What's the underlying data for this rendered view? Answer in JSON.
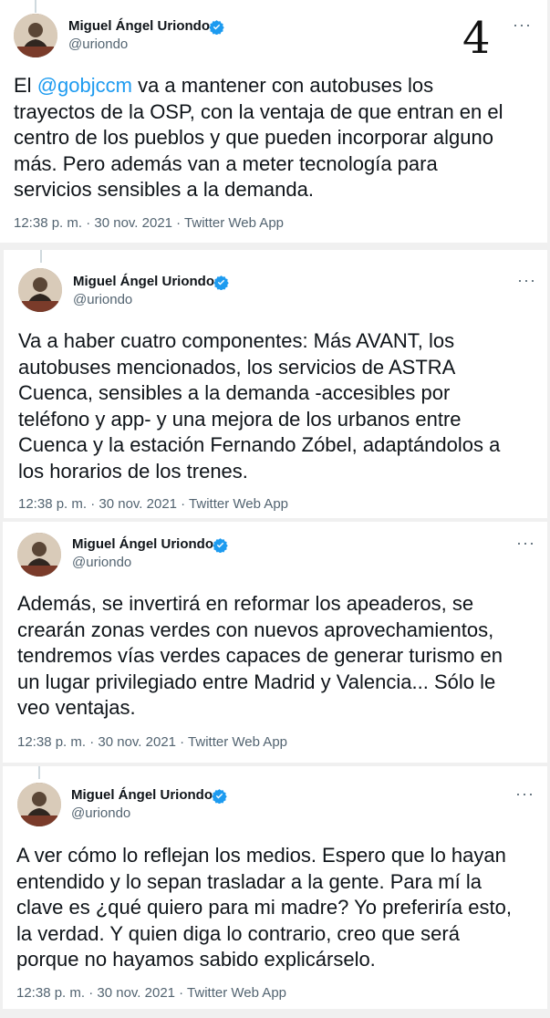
{
  "page_number": "4",
  "tweets": [
    {
      "name": "Miguel Ángel Uriondo",
      "handle": "@uriondo",
      "text_pre": "El ",
      "mention": "@gobjccm",
      "text_post": " va a mantener con autobuses los\ntrayectos de la OSP, con la ventaja de que entran en el\ncentro de los pueblos y que pueden incorporar alguno\nmás. Pero además van a meter tecnología para\nservicios sensibles a la demanda.",
      "meta": "12:38 p. m. · 30 nov. 2021 · Twitter Web App"
    },
    {
      "name": "Miguel Ángel Uriondo",
      "handle": "@uriondo",
      "text": "Va a haber cuatro componentes: Más AVANT, los\nautobuses mencionados, los servicios de ASTRA\nCuenca, sensibles a la demanda -accesibles por\nteléfono y app- y una mejora de los urbanos entre\nCuenca y la estación Fernando Zóbel, adaptándolos a\nlos horarios de los trenes.",
      "meta": "12:38 p. m. · 30 nov. 2021 · Twitter Web App"
    },
    {
      "name": "Miguel Ángel Uriondo",
      "handle": "@uriondo",
      "text": "Además, se invertirá en reformar los apeaderos, se\ncrearán zonas verdes con nuevos aprovechamientos,\ntendremos vías verdes capaces de generar turismo en\nun lugar privilegiado entre Madrid y Valencia... Sólo le\nveo ventajas.",
      "meta": "12:38 p. m. · 30 nov. 2021 · Twitter Web App"
    },
    {
      "name": "Miguel Ángel Uriondo",
      "handle": "@uriondo",
      "text": "A ver cómo lo reflejan los medios. Espero que lo hayan\nentendido y lo sepan trasladar a la gente. Para mí la\nclave es ¿qué quiero para mi madre? Yo preferiría esto,\nla verdad. Y quien diga lo contrario, creo que será\nporque no hayamos sabido explicárselo.",
      "meta": "12:38 p. m. · 30 nov. 2021 · Twitter Web App"
    }
  ],
  "icons": {
    "verified": "verified-badge-icon",
    "more": "more-options-icon"
  },
  "colors": {
    "link": "#1d9bf0",
    "verified": "#1d9bf0",
    "secondary_text": "#536471"
  }
}
